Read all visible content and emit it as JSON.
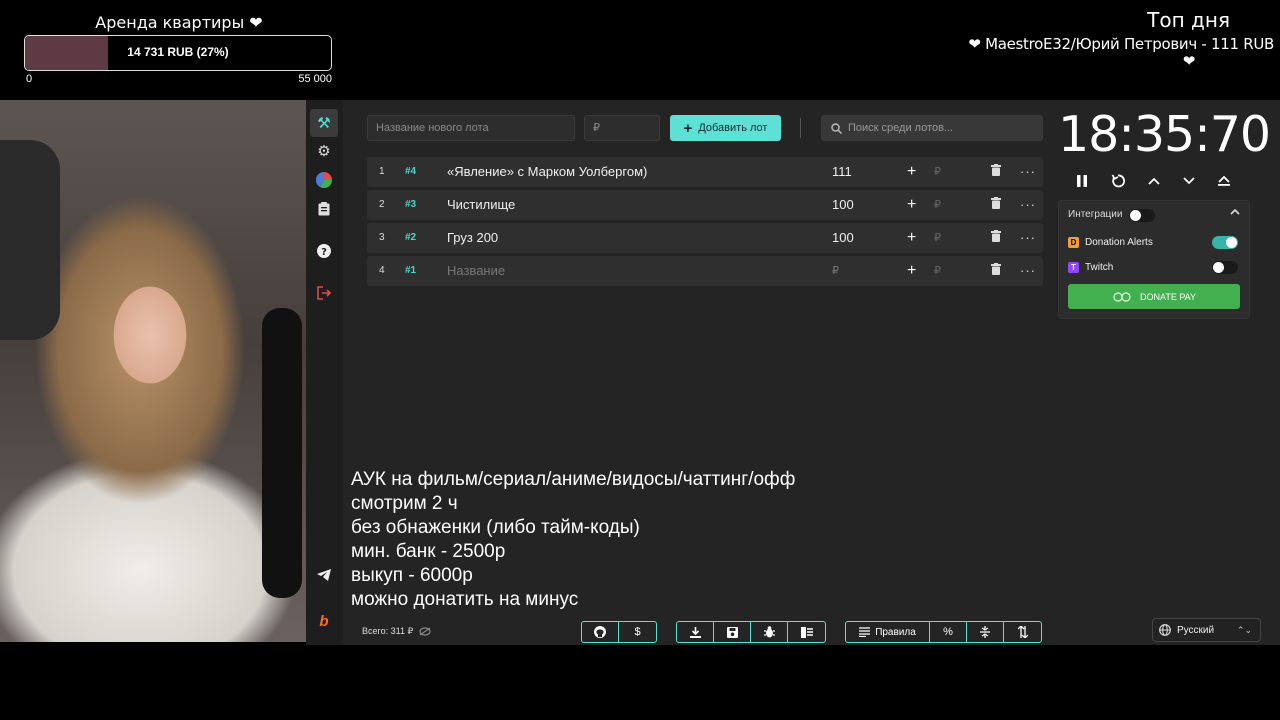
{
  "overlay": {
    "goal": {
      "title": "Аренда квартиры ❤",
      "progress_text": "14 731 RUB (27%)",
      "progress_fraction": 0.27,
      "min": "0",
      "max": "55 000",
      "fill_color": "#5e3a44"
    },
    "top_day": {
      "title": "Топ дня",
      "entry": "❤ MaestroE32/Юрий Петрович - 111 RUB",
      "heart": "❤"
    }
  },
  "sidebar": {
    "items": [
      {
        "name": "auction-icon",
        "glyph": "⚒"
      },
      {
        "name": "settings-icon",
        "glyph": "⚙"
      },
      {
        "name": "stats-icon",
        "glyph": "◕"
      },
      {
        "name": "history-icon",
        "glyph": "📋"
      },
      {
        "name": "help-icon",
        "glyph": "?"
      },
      {
        "name": "logout-icon",
        "glyph": "⇥"
      },
      {
        "name": "telegram-icon",
        "glyph": "➤"
      },
      {
        "name": "boosty-icon",
        "glyph": "b"
      }
    ]
  },
  "toolbar": {
    "new_lot_placeholder": "Название нового лота",
    "price_placeholder": "₽",
    "add_lot_label": "Добавить лот",
    "search_placeholder": "Поиск среди лотов..."
  },
  "lots": [
    {
      "index": "1",
      "id": "#4",
      "name": "«Явление» с Марком Уолбергом)",
      "amount": "111",
      "placeholder": false
    },
    {
      "index": "2",
      "id": "#3",
      "name": "Чистилище",
      "amount": "100",
      "placeholder": false
    },
    {
      "index": "3",
      "id": "#2",
      "name": "Груз 200",
      "amount": "100",
      "placeholder": false
    },
    {
      "index": "4",
      "id": "#1",
      "name": "Название",
      "amount": "₽",
      "placeholder": true
    }
  ],
  "lot_controls": {
    "plus": "+",
    "rub": "₽",
    "trash": "🗑",
    "more": "···"
  },
  "timer": {
    "value": "18:35:70"
  },
  "integrations": {
    "title": "Интеграции",
    "enabled": false,
    "services": [
      {
        "name": "Donation Alerts",
        "enabled": true,
        "color": "#f59c3b"
      },
      {
        "name": "Twitch",
        "enabled": false,
        "color": "#9146ff"
      }
    ],
    "donate_label": "DONATE PAY"
  },
  "subtitle_lines": [
    "АУК на фильм/сериал/аниме/видосы/чаттинг/офф",
    "смотрим 2 ч",
    "без обнаженки (либо тайм-коды)",
    "мин. банк - 2500р",
    "выкуп - 6000р",
    "можно донатить на минус"
  ],
  "footer": {
    "total": "Всего: 311 ₽",
    "rules_label": "Правила",
    "language": "Русский"
  },
  "colors": {
    "accent": "#5ee0d6",
    "donate_green": "#42b04e",
    "background": "#242424"
  }
}
